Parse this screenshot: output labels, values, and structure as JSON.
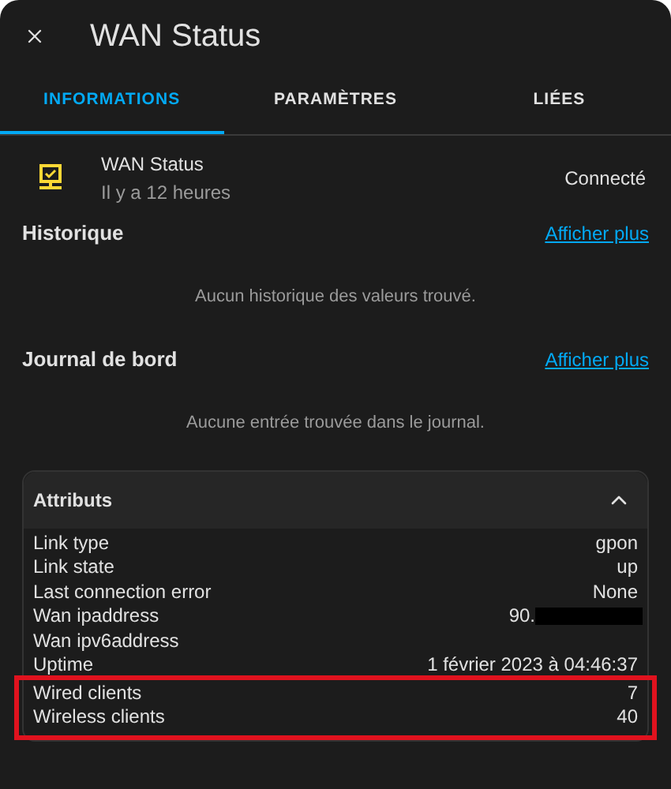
{
  "dialog": {
    "title": "WAN Status"
  },
  "tabs": [
    {
      "label": "INFORMATIONS",
      "selected": true
    },
    {
      "label": "PARAMÈTRES",
      "selected": false
    },
    {
      "label": "LIÉES",
      "selected": false
    }
  ],
  "entity": {
    "name": "WAN Status",
    "time": "Il y a 12 heures",
    "state": "Connecté"
  },
  "sections": [
    {
      "title": "Historique",
      "link": "Afficher plus",
      "empty_text": "Aucun historique des valeurs trouvé."
    },
    {
      "title": "Journal de bord",
      "link": "Afficher plus",
      "empty_text": "Aucune entrée trouvée dans le journal."
    }
  ],
  "attributes": {
    "title": "Attributs",
    "expanded": true,
    "rows": [
      {
        "name": "Link type",
        "value": "gpon",
        "redacted": false
      },
      {
        "name": "Link state",
        "value": "up",
        "redacted": false
      },
      {
        "name": "Last connection error",
        "value": "None",
        "redacted": false
      },
      {
        "name": "Wan ipaddress",
        "value": "90.",
        "redacted": true
      },
      {
        "name": "Wan ipv6address",
        "redacted": false
      },
      {
        "name": "Uptime",
        "value": "1 février 2023 à 04:46:37",
        "redacted": false
      }
    ],
    "highlighted_rows": [
      {
        "name": "Wired clients",
        "value": "7",
        "redacted": false
      },
      {
        "name": "Wireless clients",
        "value": "40",
        "redacted": false
      }
    ]
  }
}
